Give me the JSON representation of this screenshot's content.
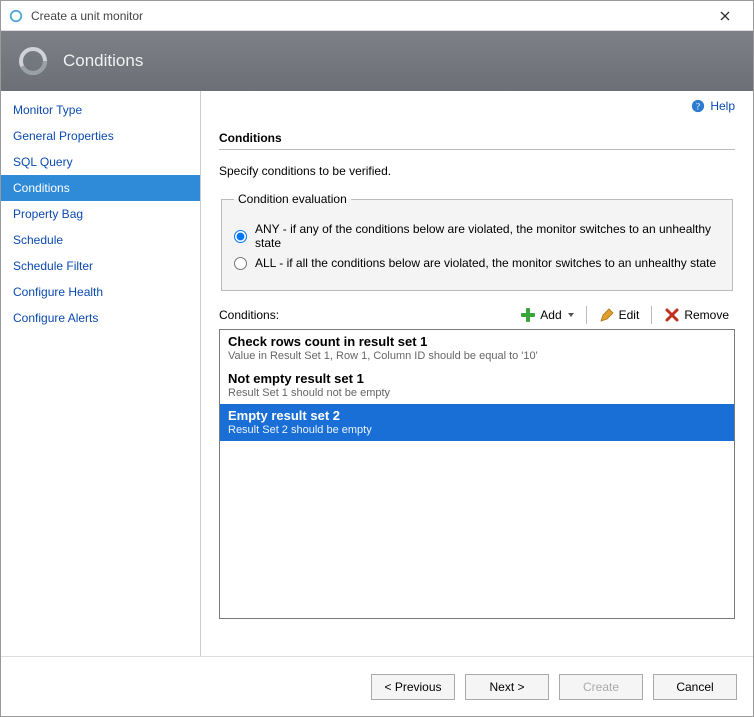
{
  "window": {
    "title": "Create a unit monitor"
  },
  "header": {
    "title": "Conditions"
  },
  "help": {
    "label": "Help"
  },
  "sidebar": {
    "items": [
      {
        "label": "Monitor Type"
      },
      {
        "label": "General Properties"
      },
      {
        "label": "SQL Query"
      },
      {
        "label": "Conditions",
        "active": true
      },
      {
        "label": "Property Bag"
      },
      {
        "label": "Schedule"
      },
      {
        "label": "Schedule Filter"
      },
      {
        "label": "Configure Health"
      },
      {
        "label": "Configure Alerts"
      }
    ]
  },
  "content": {
    "section_title": "Conditions",
    "section_sub": "Specify conditions to be verified.",
    "eval_legend": "Condition evaluation",
    "radio_any": "ANY - if any of the conditions below are violated, the monitor switches to an unhealthy state",
    "radio_all": "ALL - if all the conditions below are violated, the monitor switches to an unhealthy state",
    "radio_selected": "any",
    "conditions_label": "Conditions:",
    "toolbar": {
      "add": "Add",
      "edit": "Edit",
      "remove": "Remove"
    },
    "items": [
      {
        "title": "Check rows count in result set 1",
        "desc": "Value in Result Set 1, Row 1, Column ID should be equal to '10'",
        "selected": false
      },
      {
        "title": "Not empty result set 1",
        "desc": "Result Set 1 should not be empty",
        "selected": false
      },
      {
        "title": "Empty result set 2",
        "desc": "Result Set 2 should be empty",
        "selected": true
      }
    ]
  },
  "footer": {
    "previous": "< Previous",
    "next": "Next >",
    "create": "Create",
    "cancel": "Cancel"
  }
}
